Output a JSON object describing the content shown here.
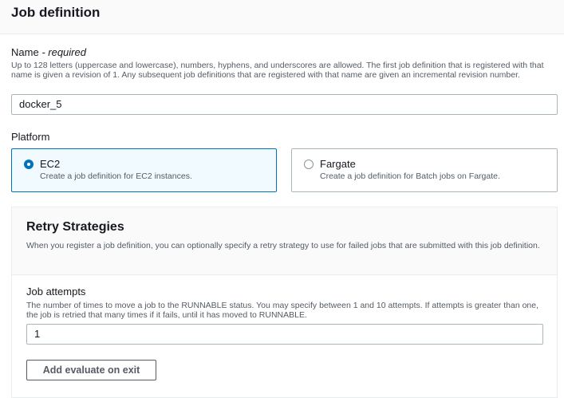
{
  "header": {
    "title": "Job definition"
  },
  "name_field": {
    "label": "Name",
    "required_marker": "- required",
    "description": "Up to 128 letters (uppercase and lowercase), numbers, hyphens, and underscores are allowed. The first job definition that is registered with that name is given a revision of 1. Any subsequent job definitions that are registered with that name are given an incremental revision number.",
    "value": "docker_5"
  },
  "platform": {
    "label": "Platform",
    "options": [
      {
        "title": "EC2",
        "description": "Create a job definition for EC2 instances.",
        "selected": true
      },
      {
        "title": "Fargate",
        "description": "Create a job definition for Batch jobs on Fargate.",
        "selected": false
      }
    ]
  },
  "retry": {
    "title": "Retry Strategies",
    "description": "When you register a job definition, you can optionally specify a retry strategy to use for failed jobs that are submitted with this job definition.",
    "attempts_label": "Job attempts",
    "attempts_description": "The number of times to move a job to the RUNNABLE status. You may specify between 1 and 10 attempts. If attempts is greater than one, the job is retried that many times if it fails, until it has moved to RUNNABLE.",
    "attempts_value": "1",
    "add_button": "Add evaluate on exit"
  },
  "colors": {
    "accent": "#0073bb",
    "border": "#aab7b8",
    "muted_text": "#545b64"
  }
}
